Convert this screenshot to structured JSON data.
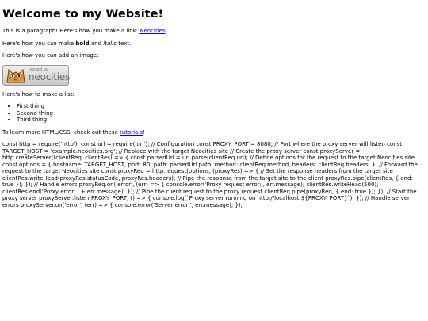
{
  "heading": "Welcome to my Website!",
  "paragraph": {
    "prefix": "This is a paragraph! Here's how you make a link: ",
    "link_text": "Neocities",
    "suffix": "."
  },
  "bold_line": {
    "prefix": "Here's how you can make ",
    "bold": "bold",
    "middle": " and ",
    "italic": "italic",
    "suffix": " text."
  },
  "image_line": "Here's how you can add an image:",
  "badge": {
    "small_text": "hosted by",
    "big_text": "neocities",
    "icon": "neocities-cat-icon"
  },
  "list_intro": "Here's how to make a list:",
  "list_items": [
    "First thing",
    "Second thing",
    "Third thing"
  ],
  "learn_line": {
    "prefix": "To learn more HTML/CSS, check out these ",
    "link_text": "tutorials",
    "suffix": "!"
  },
  "code_text": "const http = require('http'); const url = require('url'); // Configuration const PROXY_PORT = 8080; // Port where the proxy server will listen const TARGET_HOST = 'example.neocities.org'; // Replace with the target Neocities site // Create the proxy server const proxyServer = http.createServer((clientReq, clientRes) => { const parsedUrl = url.parse(clientReq.url); // Define options for the request to the target Neocities site const options = { hostname: TARGET_HOST, port: 80, path: parsedUrl.path, method: clientReq.method, headers: clientReq.headers, }; // Forward the request to the target Neocities site const proxyReq = http.request(options, (proxyRes) => { // Set the response headers from the target site clientRes.writeHead(proxyRes.statusCode, proxyRes.headers); // Pipe the response from the target site to the client proxyRes.pipe(clientRes, { end: true }); }); // Handle errors proxyReq.on('error', (err) => { console.error('Proxy request error:', err.message); clientRes.writeHead(500); clientRes.end('Proxy error: ' + err.message); }); // Pipe the client request to the proxy request clientReq.pipe(proxyReq, { end: true }); }); // Start the proxy server proxyServer.listen(PROXY_PORT, () => { console.log(`Proxy server running on http://localhost:${PROXY_PORT}`); }); // Handle server errors proxyServer.on('error', (err) => { console.error('Server error:', err.message); });"
}
